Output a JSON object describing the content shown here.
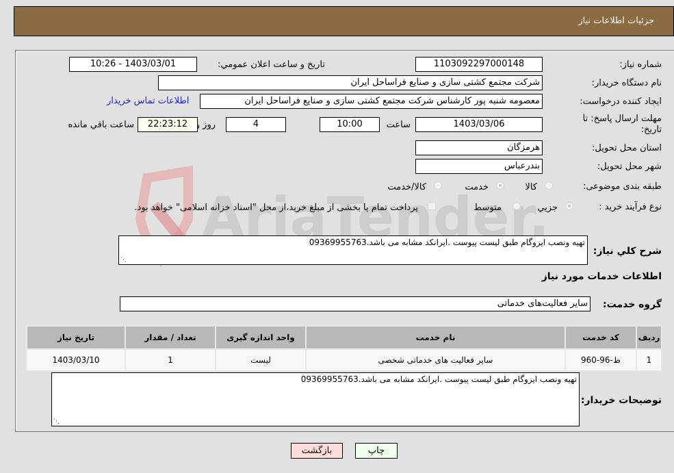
{
  "header": {
    "title": "جزئیات اطلاعات نیاز"
  },
  "form": {
    "need_number": {
      "label": "شماره نیاز:",
      "value": "1103092297000148"
    },
    "announce_datetime": {
      "label": "تاریخ و ساعت اعلان عمومي:",
      "value": "1403/03/01 - 10:26"
    },
    "buyer_org": {
      "label": "نام دستگاه خریدار:",
      "value": "شرکت مجتمع کشتی سازی و صنایع فراساحل ایران"
    },
    "requester": {
      "label": "ایجاد کننده درخواست:",
      "value": "معصومه شنبه پور کارشناس شرکت مجتمع کشتی سازی و صنایع فراساحل ایران",
      "contact_link": "اطلاعات تماس خریدار"
    },
    "deadline": {
      "label_line1": "مهلت ارسال پاسخ: تا",
      "label_line2": "تاریخ:",
      "date": "1403/03/06",
      "time_label": "ساعت",
      "time": "10:00",
      "days": "4",
      "days_label": "روز و",
      "remaining": "22:23:12",
      "remaining_label": "ساعت باقي مانده"
    },
    "province": {
      "label": "استان محل تحویل:",
      "value": "هرمزگان"
    },
    "city": {
      "label": "شهر محل تحویل:",
      "value": "بندرعباس"
    },
    "category": {
      "label": "طبقه بندی موضوعی:",
      "options": [
        "کالا",
        "خدمت",
        "کالا/خدمت"
      ],
      "selected": "خدمت"
    },
    "purchase_type": {
      "label": "نوع فرآیند خرید :",
      "options": [
        "جزيي",
        "متوسط"
      ],
      "selected": "جزيي",
      "treasury_note": "پرداخت تمام یا بخشی از مبلغ خرید،از محل \"اسناد خزانه اسلامی\" خواهد بود."
    },
    "description": {
      "label": "شرح کلي نیاز:",
      "value": "تهیه ونصب ایزوگام طبق لیست پیوست .ایرانکد مشابه می باشد.09369955763"
    },
    "services_section_title": "اطلاعات خدمات مورد نیاز",
    "service_group": {
      "label": "گروه خدمت:",
      "value": "سایر فعالیت‌های خدماتی"
    }
  },
  "table": {
    "columns": [
      "ردیف",
      "کد خدمت",
      "نام خدمت",
      "واحد اندازه گیری",
      "تعداد / مقدار",
      "تاریخ نیاز"
    ],
    "rows": [
      [
        "1",
        "ط-96-960",
        "سایر فعالیت های خدماتی شخصی",
        "لیست",
        "1",
        "1403/03/10"
      ]
    ]
  },
  "buyer_notes": {
    "label": "توضیحات خریدار:",
    "value": "تهیه ونصب ایزوگام طبق لیست پیوست .ایرانکد مشابه می باشد.09369955763"
  },
  "buttons": {
    "print": "چاپ",
    "back": "بازگشت"
  },
  "watermark": {
    "text": "AriaTender.neT"
  },
  "colors": {
    "header_bg": "#8b6c42",
    "print_bg": "#eeffee",
    "back_bg": "#ffdddd",
    "link": "#2222cc"
  }
}
